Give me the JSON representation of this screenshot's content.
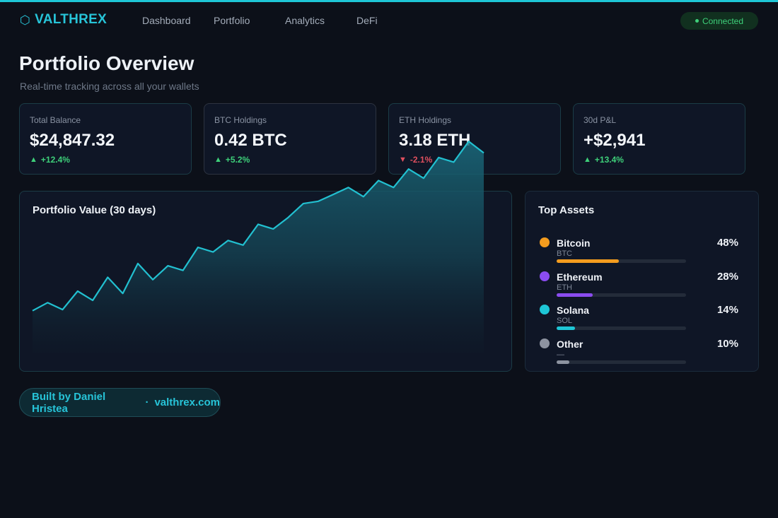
{
  "nav": {
    "brand_icon": "hexagon-icon",
    "brand": "VALTHREX",
    "links": [
      "Dashboard",
      "Portfolio",
      "Analytics",
      "DeFi"
    ],
    "status": "Connected",
    "accent": "#27c4d8",
    "status_color": "#3ed07a"
  },
  "header": {
    "title": "Portfolio Overview",
    "subtitle": "Real-time tracking across all your wallets"
  },
  "stats": [
    {
      "label": "Total Balance",
      "value": "$24,847.32",
      "change": "+12.4%",
      "direction": "up"
    },
    {
      "label": "BTC Holdings",
      "value": "0.42 BTC",
      "change": "+5.2%",
      "direction": "up"
    },
    {
      "label": "ETH Holdings",
      "value": "3.18 ETH",
      "change": "-2.1%",
      "direction": "down"
    },
    {
      "label": "30d P&L",
      "value": "+$2,941",
      "change": "+13.4%",
      "direction": "up"
    }
  ],
  "chart": {
    "title": "Portfolio Value (30 days)"
  },
  "chart_data": {
    "type": "area",
    "title": "Portfolio Value (30 days)",
    "xlabel": "",
    "ylabel": "",
    "grid": false,
    "color": "#22c0d0",
    "values": [
      18.5,
      22,
      19,
      27,
      23,
      33,
      26,
      39,
      32,
      38,
      36,
      46,
      44,
      49,
      47,
      56,
      54,
      59,
      65,
      66,
      69,
      72,
      68,
      75,
      72,
      80,
      76,
      85,
      83,
      92,
      87
    ]
  },
  "assets": {
    "title": "Top Assets",
    "items": [
      {
        "name": "Bitcoin",
        "symbol": "BTC",
        "percent_label": "48%",
        "share": 0.48,
        "color": "#f39c1e"
      },
      {
        "name": "Ethereum",
        "symbol": "ETH",
        "percent_label": "28%",
        "share": 0.28,
        "color": "#8b4cf0"
      },
      {
        "name": "Solana",
        "symbol": "SOL",
        "percent_label": "14%",
        "share": 0.14,
        "color": "#1ec6d6"
      },
      {
        "name": "Other",
        "symbol": "—",
        "percent_label": "10%",
        "share": 0.1,
        "color": "#8d93a0"
      }
    ]
  },
  "footer": {
    "author": "Built by Daniel Hristea",
    "separator": "·",
    "site": "valthrex.com"
  }
}
